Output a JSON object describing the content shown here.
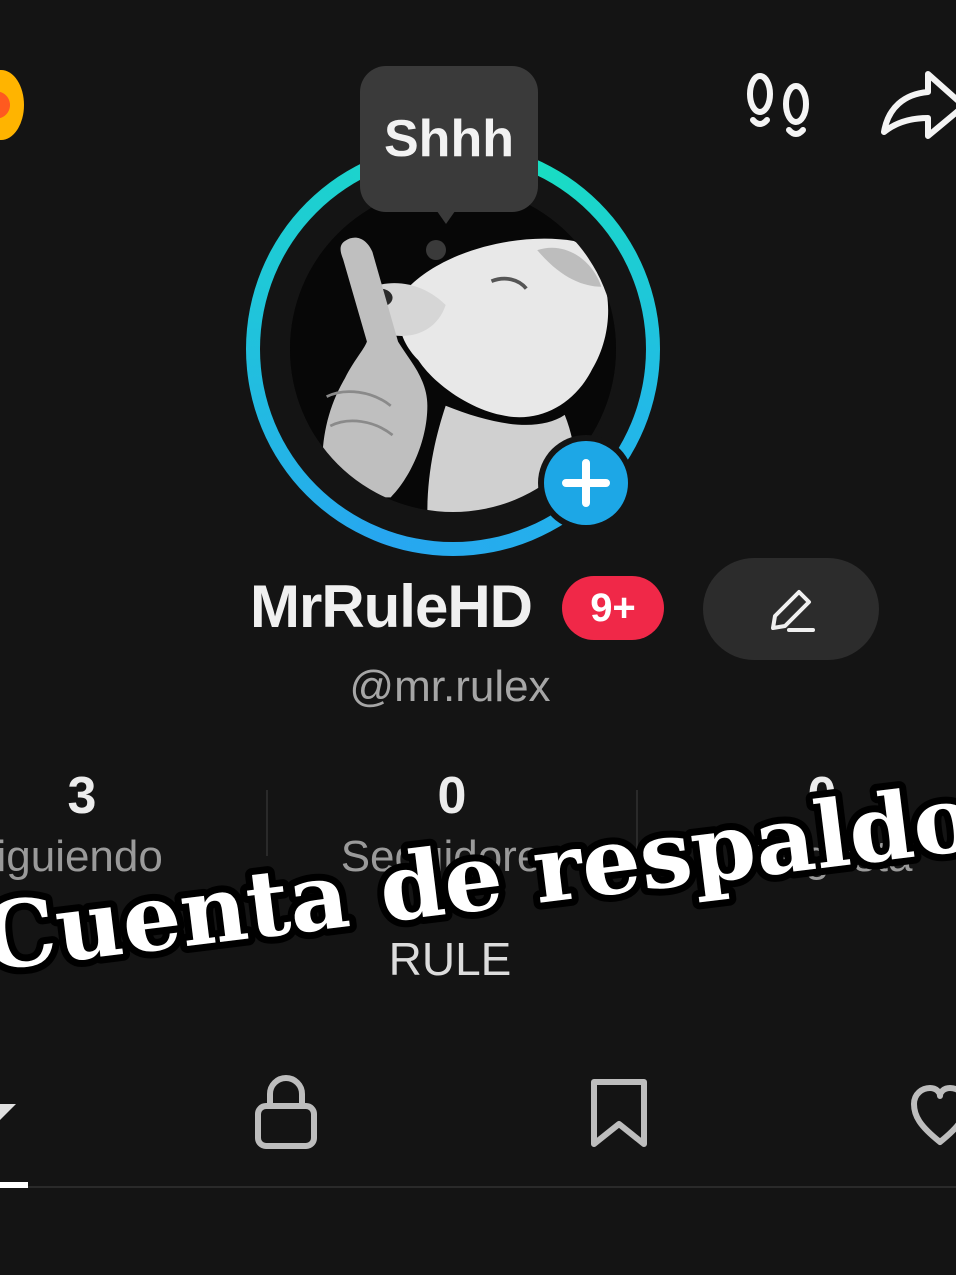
{
  "profile": {
    "status_bubble": "Shhh",
    "display_name": "MrRuleHD",
    "notification_badge": "9+",
    "username": "@mr.rulex",
    "bio": "RULE"
  },
  "stats": [
    {
      "value": "3",
      "label": "Siguiendo"
    },
    {
      "value": "0",
      "label": "Seguidores"
    },
    {
      "value": "0",
      "label": "Me gusta"
    }
  ],
  "overlay": {
    "caption": "Cuenta de respaldo"
  },
  "icons": {
    "coin": "coin-icon",
    "footprints": "footprints-icon",
    "share": "share-icon",
    "add": "plus-icon",
    "edit": "pencil-icon",
    "tab_videos": "chevron-down-icon",
    "tab_private": "lock-icon",
    "tab_saved": "bookmark-icon",
    "tab_liked": "heart-icon"
  },
  "colors": {
    "background": "#141414",
    "ring_blue": "#27a6f0",
    "ring_teal": "#18e0c0",
    "badge_red": "#f02848",
    "add_button": "#1da7e6"
  }
}
